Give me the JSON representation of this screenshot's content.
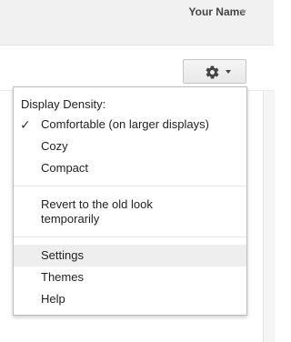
{
  "header": {
    "account_name": "Your Name"
  },
  "settings_menu": {
    "display_density_heading": "Display Density:",
    "density_options": [
      {
        "label": "Comfortable (on larger displays)",
        "selected": true
      },
      {
        "label": "Cozy",
        "selected": false
      },
      {
        "label": "Compact",
        "selected": false
      }
    ],
    "revert_label": "Revert to the old look\ntemporarily",
    "settings_label": "Settings",
    "themes_label": "Themes",
    "help_label": "Help",
    "check_glyph": "✓"
  },
  "icons": {
    "gear": "gear-icon",
    "caret": "chevron-down-icon",
    "check": "checkmark-icon"
  },
  "colors": {
    "topbar_bg": "#f1f1f1",
    "menu_highlight": "#eeeeee",
    "text": "#222222"
  }
}
